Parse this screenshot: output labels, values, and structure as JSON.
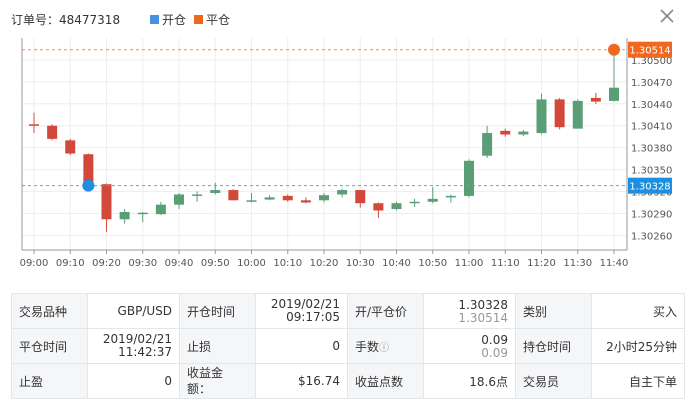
{
  "header": {
    "order_text": "订单号：48477318",
    "legend": [
      {
        "label": "开仓",
        "color": "#4a90e2"
      },
      {
        "label": "平仓",
        "color": "#f06820"
      }
    ],
    "close_icon": "close-icon"
  },
  "chart_data": {
    "type": "candlestick",
    "time_labels": [
      "09:00",
      "09:10",
      "09:20",
      "09:30",
      "09:40",
      "09:50",
      "10:00",
      "10:10",
      "10:20",
      "10:30",
      "10:40",
      "10:50",
      "11:00",
      "11:10",
      "11:20",
      "11:30",
      "11:40"
    ],
    "y_ticks": [
      "1.30500",
      "1.30470",
      "1.30440",
      "1.30410",
      "1.30380",
      "1.30350",
      "1.30320",
      "1.30290",
      "1.30260"
    ],
    "ylim": [
      1.3024,
      1.3053
    ],
    "open_price": 1.30328,
    "close_price": 1.30514,
    "open_price_label": "1.30328",
    "close_price_label": "1.30514",
    "open_marker_time_index": 1.5,
    "close_marker_time_index": 16.0,
    "up_color": "#5a9e76",
    "down_color": "#d2493b",
    "candles": [
      {
        "t": 0.0,
        "o": 1.30412,
        "c": 1.3041,
        "h": 1.30428,
        "l": 1.304
      },
      {
        "t": 0.5,
        "o": 1.3041,
        "c": 1.30392,
        "h": 1.30412,
        "l": 1.3039
      },
      {
        "t": 1.0,
        "o": 1.3039,
        "c": 1.30372,
        "h": 1.30392,
        "l": 1.3037
      },
      {
        "t": 1.5,
        "o": 1.30371,
        "c": 1.3033,
        "h": 1.30372,
        "l": 1.30326
      },
      {
        "t": 2.0,
        "o": 1.3033,
        "c": 1.30282,
        "h": 1.30331,
        "l": 1.30265
      },
      {
        "t": 2.5,
        "o": 1.30282,
        "c": 1.30292,
        "h": 1.30296,
        "l": 1.30276
      },
      {
        "t": 3.0,
        "o": 1.30291,
        "c": 1.30291,
        "h": 1.30292,
        "l": 1.30278
      },
      {
        "t": 3.5,
        "o": 1.30289,
        "c": 1.30302,
        "h": 1.30306,
        "l": 1.30288
      },
      {
        "t": 4.0,
        "o": 1.30302,
        "c": 1.30316,
        "h": 1.30318,
        "l": 1.30296
      },
      {
        "t": 4.5,
        "o": 1.30316,
        "c": 1.30316,
        "h": 1.3032,
        "l": 1.30306
      },
      {
        "t": 5.0,
        "o": 1.30318,
        "c": 1.30322,
        "h": 1.30332,
        "l": 1.30316
      },
      {
        "t": 5.5,
        "o": 1.30322,
        "c": 1.30308,
        "h": 1.30323,
        "l": 1.30308
      },
      {
        "t": 6.0,
        "o": 1.30308,
        "c": 1.30308,
        "h": 1.30318,
        "l": 1.30305
      },
      {
        "t": 6.5,
        "o": 1.30309,
        "c": 1.30312,
        "h": 1.30315,
        "l": 1.30308
      },
      {
        "t": 7.0,
        "o": 1.30314,
        "c": 1.30308,
        "h": 1.30316,
        "l": 1.30306
      },
      {
        "t": 7.5,
        "o": 1.30308,
        "c": 1.30305,
        "h": 1.30312,
        "l": 1.30304
      },
      {
        "t": 8.0,
        "o": 1.30308,
        "c": 1.30315,
        "h": 1.30318,
        "l": 1.30305
      },
      {
        "t": 8.5,
        "o": 1.30316,
        "c": 1.30322,
        "h": 1.30324,
        "l": 1.30312
      },
      {
        "t": 9.0,
        "o": 1.30322,
        "c": 1.30304,
        "h": 1.30322,
        "l": 1.30298
      },
      {
        "t": 9.5,
        "o": 1.30304,
        "c": 1.30294,
        "h": 1.30305,
        "l": 1.30284
      },
      {
        "t": 10.0,
        "o": 1.30296,
        "c": 1.30304,
        "h": 1.30306,
        "l": 1.30294
      },
      {
        "t": 10.5,
        "o": 1.30304,
        "c": 1.30306,
        "h": 1.3031,
        "l": 1.30299
      },
      {
        "t": 11.0,
        "o": 1.30306,
        "c": 1.3031,
        "h": 1.30326,
        "l": 1.30304
      },
      {
        "t": 11.5,
        "o": 1.30312,
        "c": 1.30314,
        "h": 1.30316,
        "l": 1.30305
      },
      {
        "t": 12.0,
        "o": 1.30314,
        "c": 1.30362,
        "h": 1.30364,
        "l": 1.30312
      },
      {
        "t": 12.5,
        "o": 1.30369,
        "c": 1.304,
        "h": 1.3041,
        "l": 1.30366
      },
      {
        "t": 13.0,
        "o": 1.30403,
        "c": 1.30398,
        "h": 1.30406,
        "l": 1.30395
      },
      {
        "t": 13.5,
        "o": 1.30398,
        "c": 1.30402,
        "h": 1.30404,
        "l": 1.30396
      },
      {
        "t": 14.0,
        "o": 1.304,
        "c": 1.30446,
        "h": 1.30454,
        "l": 1.30398
      },
      {
        "t": 14.5,
        "o": 1.30446,
        "c": 1.30408,
        "h": 1.30448,
        "l": 1.30405
      },
      {
        "t": 15.0,
        "o": 1.30406,
        "c": 1.30444,
        "h": 1.30446,
        "l": 1.30406
      },
      {
        "t": 15.5,
        "o": 1.30448,
        "c": 1.30443,
        "h": 1.30455,
        "l": 1.3044
      },
      {
        "t": 16.0,
        "o": 1.30444,
        "c": 1.30462,
        "h": 1.3052,
        "l": 1.30443
      }
    ]
  },
  "info": {
    "row1": {
      "symbol_label": "交易品种",
      "symbol_value": "GBP/USD",
      "open_time_label": "开仓时间",
      "open_time_date": "2019/02/21",
      "open_time_time": "09:17:05",
      "open_close_price_label": "开/平仓价",
      "open_price_value": "1.30328",
      "close_price_value": "1.30514",
      "type_label": "类别",
      "type_value": "买入"
    },
    "row2": {
      "close_time_label": "平仓时间",
      "close_time_date": "2019/02/21",
      "close_time_time": "11:42:37",
      "stop_loss_label": "止损",
      "stop_loss_value": "0",
      "fee_label": "手数",
      "fee_icon": "ⓘ",
      "fee_value": "0.09",
      "fee_value2": "0.09",
      "hold_time_label": "持仓时间",
      "hold_time_value": "2小时25分钟"
    },
    "row3": {
      "take_profit_label": "止盈",
      "take_profit_value": "0",
      "profit_label_1": "收益金",
      "profit_label_2": "额：",
      "profit_value": "$16.74",
      "pips_label": "收益点数",
      "pips_value": "18.6点",
      "trader_label": "交易员",
      "trader_value": "自主下单"
    }
  }
}
